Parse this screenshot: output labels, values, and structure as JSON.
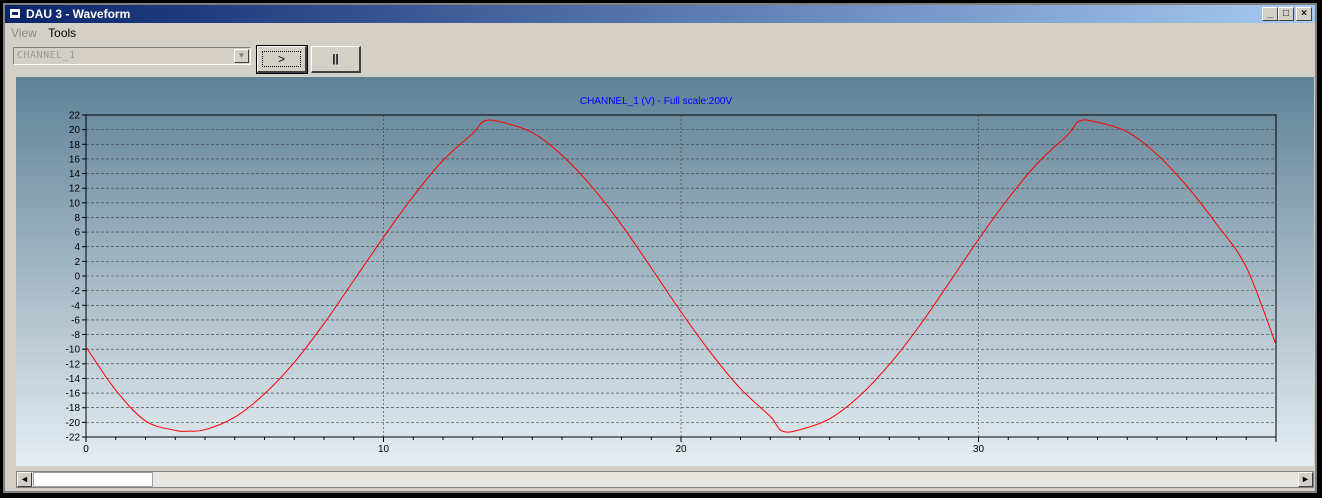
{
  "window": {
    "title": "DAU 3 - Waveform"
  },
  "window_buttons": {
    "minimize": "_",
    "maximize": "□",
    "close": "×"
  },
  "menu": {
    "view": "View",
    "tools": "Tools"
  },
  "toolbar": {
    "channel_select": {
      "value": "CHANNEL_1"
    },
    "play_label": ">",
    "pause_label": "||"
  },
  "colors": {
    "title_start": "#0a246a",
    "title_end": "#a6caf0",
    "plot_bg_top": "#5f8196",
    "plot_bg_bottom": "#e6edf2",
    "waveform": "#ff0000",
    "chart_title": "#0000ff"
  },
  "scrollbar": {
    "position": 0.0
  },
  "chart_data": {
    "type": "line",
    "title": "CHANNEL_1 (V) - Full scale:200V",
    "xlim": [
      0,
      40
    ],
    "ylim": [
      -22,
      22
    ],
    "x_ticks": [
      0,
      10,
      20,
      30
    ],
    "y_ticks": [
      22,
      20,
      18,
      16,
      14,
      12,
      10,
      8,
      6,
      4,
      2,
      0,
      -2,
      -4,
      -6,
      -8,
      -10,
      -12,
      -14,
      -16,
      -18,
      -20,
      -22
    ],
    "grid": true,
    "series": [
      {
        "color": "#ff0000",
        "x": [
          0,
          1,
          2,
          3,
          3.4,
          4,
          5,
          6,
          7,
          8,
          9,
          10,
          11,
          12,
          13,
          13.4,
          14,
          15,
          16,
          17,
          18,
          19,
          20,
          21,
          22,
          23,
          23.4,
          24,
          25,
          26,
          27,
          28,
          29,
          30,
          31,
          32,
          33,
          33.4,
          34,
          35,
          36,
          37,
          38,
          39,
          40
        ],
        "y": [
          -9.7,
          -15.6,
          -19.8,
          -21.1,
          -21.2,
          -21,
          -19.3,
          -16.1,
          -11.8,
          -6.5,
          -0.6,
          5.3,
          10.9,
          15.8,
          19.5,
          21.2,
          21.0,
          19.6,
          16.5,
          12.2,
          7.0,
          1.1,
          -4.9,
          -10.5,
          -15.4,
          -19.2,
          -21.2,
          -21.0,
          -19.5,
          -16.4,
          -12.1,
          -6.9,
          -1.0,
          5.0,
          10.6,
          15.5,
          19.3,
          21.2,
          21.0,
          19.7,
          16.6,
          12.3,
          7.1,
          1.2,
          -9.4
        ]
      }
    ]
  }
}
